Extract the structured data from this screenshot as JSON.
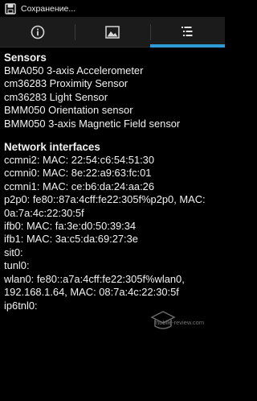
{
  "status_bar": {
    "text": "Сохранение...",
    "icon": "save-icon"
  },
  "tabs": [
    {
      "icon": "info-icon",
      "active": false
    },
    {
      "icon": "image-icon",
      "active": false
    },
    {
      "icon": "list-icon",
      "active": true
    }
  ],
  "sensors": {
    "title": "Sensors",
    "items": [
      "BMA050 3-axis Accelerometer",
      "cm36283  Proximity Sensor",
      "cm36283 Light Sensor",
      "BMM050 Orientation sensor",
      "BMM050 3-axis Magnetic Field sensor"
    ]
  },
  "network": {
    "title": "Network interfaces",
    "items": [
      "ccmni2: MAC: 22:54:c6:54:51:30",
      "ccmni0: MAC: 8e:22:a9:63:fc:01",
      "ccmni1: MAC: ce:b6:da:24:aa:26",
      "p2p0: fe80::87a:4cff:fe22:305f%p2p0, MAC:",
      "0a:7a:4c:22:30:5f",
      "ifb0: MAC: fa:3e:d0:50:39:34",
      "ifb1: MAC: 3a:c5:da:69:27:3e",
      "sit0:",
      "tunl0:",
      "wlan0: fe80::a7a:4cff:fe22:305f%wlan0,",
      "192.168.1.64, MAC: 08:7a:4c:22:30:5f",
      "ip6tnl0:"
    ]
  },
  "watermark": "mobile-review.com",
  "colors": {
    "accent": "#2f9bd6",
    "background": "#000000",
    "tab_bar": "#1b1b1b"
  }
}
